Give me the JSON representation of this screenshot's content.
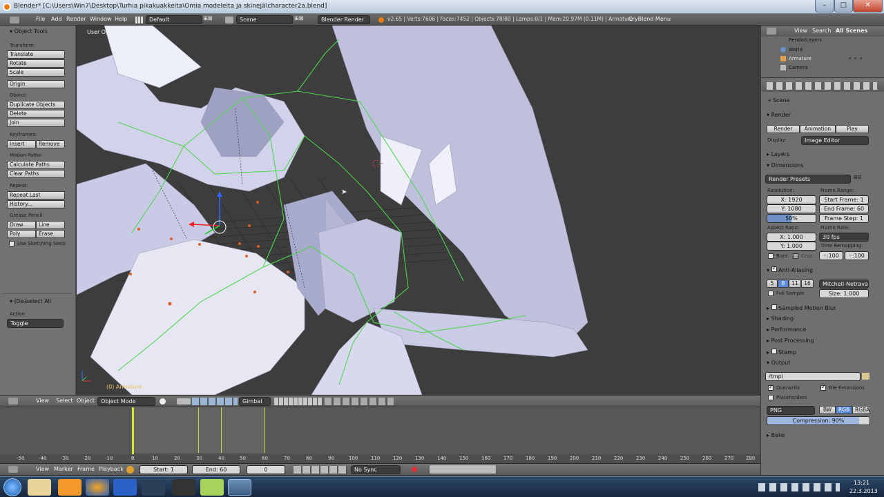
{
  "window": {
    "title": "Blender* [C:\\Users\\Win7\\Desktop\\Turhia pikakuakkeita\\Omia modeleita ja skinejä\\character2a.blend]",
    "minimize": "–",
    "maximize": "□",
    "close": "✕"
  },
  "infobar": {
    "menus": [
      "File",
      "Add",
      "Render",
      "Window",
      "Help"
    ],
    "layout": "Default",
    "scene": "Scene",
    "engine": "Blender Render",
    "stats": "v2.65 | Verts:7606 | Faces:7452 | Objects:78/80 | Lamps:0/1 | Mem:20.97M (0.11M) | Armature",
    "cryblend": "CryBlend Menu"
  },
  "left": {
    "header": "Object Tools",
    "transform": "Transform:",
    "translate": "Translate",
    "rotate": "Rotate",
    "scale": "Scale",
    "origin": "Origin",
    "object": "Object:",
    "duplicate": "Duplicate Objects",
    "delete": "Delete",
    "join": "Join",
    "keyframes": "Keyframes:",
    "insert": "Insert",
    "remove": "Remove",
    "motion": "Motion Paths:",
    "calc": "Calculate Paths",
    "clear": "Clear Paths",
    "repeat": "Repeat:",
    "repeat_last": "Repeat Last",
    "history": "History...",
    "grease": "Grease Pencil:",
    "draw": "Draw",
    "line": "Line",
    "poly": "Poly",
    "erase": "Erase",
    "sketch": "Use Sketching Sessi",
    "deselect": "(De)select All",
    "action": "Action",
    "toggle": "Toggle"
  },
  "viewport": {
    "label": "User Ortho",
    "object": "(0) Armature"
  },
  "vphdr": {
    "view": "View",
    "select": "Select",
    "object": "Object",
    "mode": "Object Mode",
    "orient": "Gimbal"
  },
  "timeline": {
    "ticks": [
      "-50",
      "-40",
      "-30",
      "-20",
      "-10",
      "0",
      "10",
      "20",
      "30",
      "40",
      "50",
      "60",
      "70",
      "80",
      "90",
      "100",
      "110",
      "120",
      "130",
      "140",
      "150",
      "160",
      "170",
      "180",
      "190",
      "200",
      "210",
      "220",
      "230",
      "240",
      "250",
      "260",
      "270",
      "280"
    ]
  },
  "tlhdr": {
    "view": "View",
    "marker": "Marker",
    "frame": "Frame",
    "playback": "Playback",
    "start": "Start: 1",
    "end": "End: 60",
    "current": "0",
    "sync": "No Sync"
  },
  "outliner": {
    "view": "View",
    "search": "Search",
    "scenes": "All Scenes",
    "items": [
      "RenderLayers",
      "World",
      "Armature",
      "Camera"
    ]
  },
  "props": {
    "scene": "Scene",
    "render": "Render",
    "render_btn": "Render",
    "anim_btn": "Animation",
    "play_btn": "Play",
    "display": "Display:",
    "display_val": "Image Editor",
    "layers": "Layers",
    "dimensions": "Dimensions",
    "presets": "Render Presets",
    "resolution": "Resolution:",
    "resx": "X: 1920",
    "resy": "Y: 1080",
    "percent": "50%",
    "frame_range": "Frame Range:",
    "start_frame": "Start Frame: 1",
    "end_frame": "End Frame: 60",
    "frame_step": "Frame Step: 1",
    "aspect": "Aspect Ratio:",
    "ax": "X: 1.000",
    "ay": "Y: 1.000",
    "frame_rate": "Frame Rate:",
    "fps": "30 fps",
    "remap": "Time Remapping:",
    "remap_old": "◦:100",
    "remap_new": "◦:100",
    "bord": "Bord",
    "crop": "Crop",
    "aa": "Anti-Aliasing",
    "aa_levels": [
      "5",
      "8",
      "11",
      "16"
    ],
    "filter": "Mitchell-Netravali",
    "full_sample": "Full Sample",
    "size": "Size: 1.000",
    "motion_blur": "Sampled Motion Blur",
    "shading": "Shading",
    "performance": "Performance",
    "post": "Post Processing",
    "stamp": "Stamp",
    "output": "Output",
    "path": "/tmp\\",
    "overwrite": "Overwrite",
    "file_ext": "File Extensions",
    "placeholders": "Placeholders",
    "format": "PNG",
    "bw": "BW",
    "rgb": "RGB",
    "rgba": "RGBA",
    "compression": "Compression: 90%",
    "bake": "Bake"
  },
  "clock": {
    "time": "13:21",
    "date": "22.3.2013"
  },
  "colors": {
    "bone": "#4cd64c",
    "mesh": "#c8c8e8",
    "accent": "#5a8ad8"
  }
}
